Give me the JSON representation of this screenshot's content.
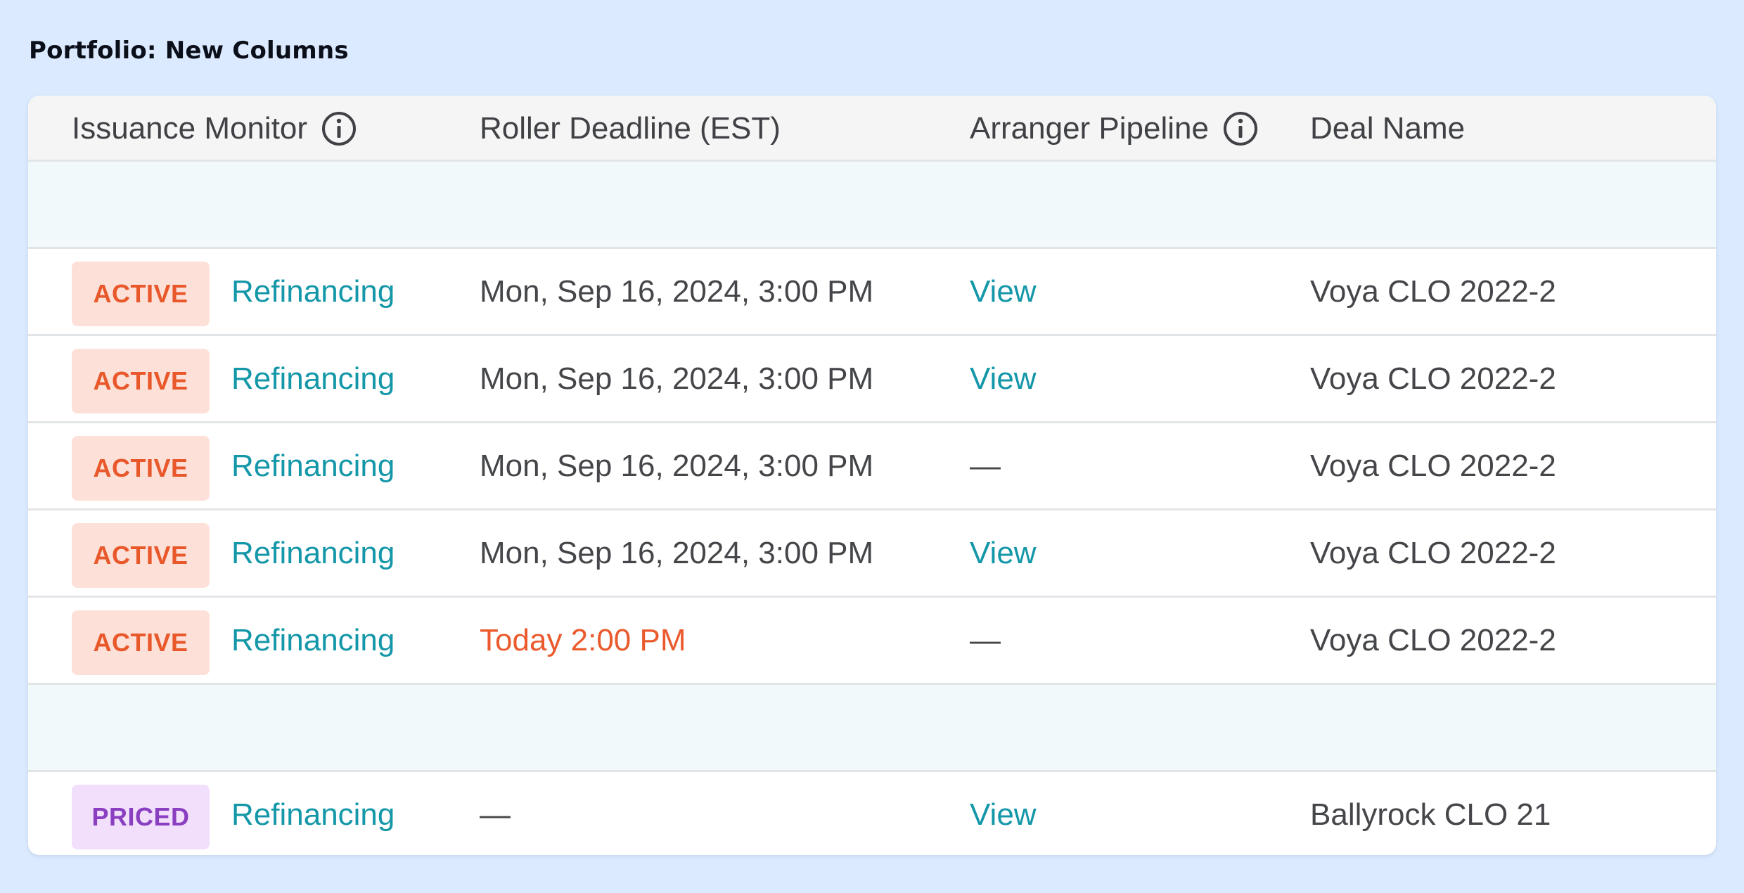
{
  "page": {
    "title": "Portfolio: New Columns"
  },
  "table": {
    "columns": [
      {
        "label": "Issuance Monitor",
        "has_info_icon": true
      },
      {
        "label": "Roller Deadline (EST)",
        "has_info_icon": false
      },
      {
        "label": "Arranger Pipeline",
        "has_info_icon": true
      },
      {
        "label": "Deal Name",
        "has_info_icon": false
      }
    ],
    "rows": [
      {
        "spacer": true
      },
      {
        "status": "ACTIVE",
        "type": "Refinancing",
        "deadline": "Mon, Sep 16, 2024, 3:00 PM",
        "deadline_alert": false,
        "pipeline": "View",
        "deal": "Voya CLO 2022-2"
      },
      {
        "status": "ACTIVE",
        "type": "Refinancing",
        "deadline": "Mon, Sep 16, 2024, 3:00 PM",
        "deadline_alert": false,
        "pipeline": "View",
        "deal": "Voya CLO 2022-2"
      },
      {
        "status": "ACTIVE",
        "type": "Refinancing",
        "deadline": "Mon, Sep 16, 2024, 3:00 PM",
        "deadline_alert": false,
        "pipeline": "—",
        "deal": "Voya CLO 2022-2"
      },
      {
        "status": "ACTIVE",
        "type": "Refinancing",
        "deadline": "Mon, Sep 16, 2024, 3:00 PM",
        "deadline_alert": false,
        "pipeline": "View",
        "deal": "Voya CLO 2022-2"
      },
      {
        "status": "ACTIVE",
        "type": "Refinancing",
        "deadline": "Today 2:00 PM",
        "deadline_alert": true,
        "pipeline": "—",
        "deal": "Voya CLO 2022-2"
      },
      {
        "spacer": true
      },
      {
        "status": "PRICED",
        "type": "Refinancing",
        "deadline": "—",
        "deadline_alert": false,
        "pipeline": "View",
        "deal": "Ballyrock CLO 21"
      }
    ]
  },
  "colors": {
    "background": "#dbeafe",
    "active_badge_bg": "#fde1d9",
    "active_badge_text": "#e8582a",
    "priced_badge_bg": "#f1dffc",
    "priced_badge_text": "#8a3fc0",
    "link": "#1497a8",
    "deadline_alert": "#ea5a2c"
  }
}
